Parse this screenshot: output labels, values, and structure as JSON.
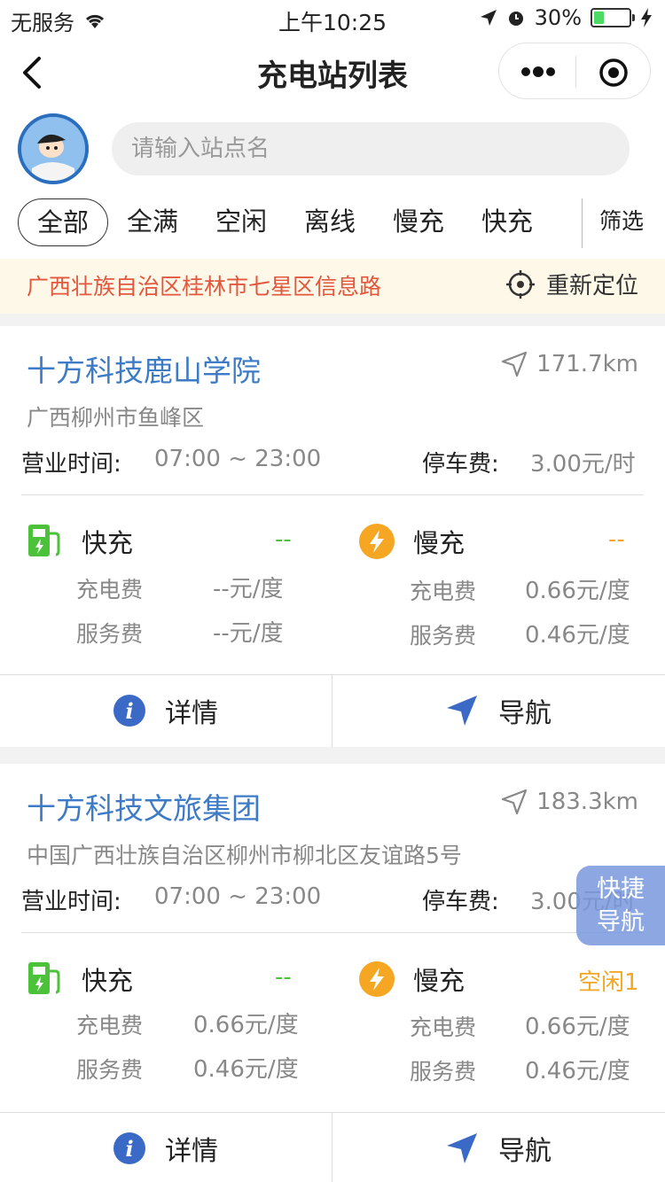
{
  "status": {
    "carrier": "无服务",
    "time": "上午10:25",
    "battery": "30%"
  },
  "nav": {
    "title": "充电站列表"
  },
  "search": {
    "placeholder": "请输入站点名"
  },
  "tabs": [
    {
      "label": "全部",
      "active": true
    },
    {
      "label": "全满"
    },
    {
      "label": "空闲"
    },
    {
      "label": "离线"
    },
    {
      "label": "慢充"
    },
    {
      "label": "快充"
    }
  ],
  "filter_label": "筛选",
  "location": {
    "address": "广西壮族自治区桂林市七星区信息路",
    "relocate_label": "重新定位"
  },
  "labels": {
    "hours": "营业时间:",
    "parking": "停车费:",
    "fast": "快充",
    "slow": "慢充",
    "charge_fee": "充电费",
    "service_fee": "服务费",
    "detail": "详情",
    "navigate": "导航"
  },
  "stations": [
    {
      "name": "十方科技鹿山学院",
      "distance": "171.7km",
      "address": "广西柳州市鱼峰区",
      "hours": "07:00 ~ 23:00",
      "parking_fee": "3.00元/时",
      "fast": {
        "status": "--",
        "charge_fee": "--元/度",
        "service_fee": "--元/度"
      },
      "slow": {
        "status": "--",
        "charge_fee": "0.66元/度",
        "service_fee": "0.46元/度"
      }
    },
    {
      "name": "十方科技文旅集团",
      "distance": "183.3km",
      "address": "中国广西壮族自治区柳州市柳北区友谊路5号",
      "hours": "07:00 ~ 23:00",
      "parking_fee": "3.00元/时",
      "fast": {
        "status": "--",
        "charge_fee": "0.66元/度",
        "service_fee": "0.46元/度"
      },
      "slow": {
        "status": "空闲1",
        "charge_fee": "0.66元/度",
        "service_fee": "0.46元/度"
      }
    }
  ],
  "float_button": {
    "line1": "快捷",
    "line2": "导航"
  },
  "colors": {
    "accent_blue": "#3d7bc6",
    "fast_green": "#4cc13a",
    "slow_orange": "#f5a623",
    "location_red": "#e2573d"
  }
}
